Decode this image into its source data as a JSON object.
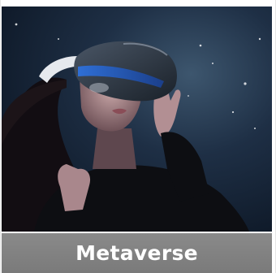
{
  "card": {
    "title": "Metaverse",
    "image_subject": "vr-headset-woman-photo"
  },
  "colors": {
    "caption_background": "#7f7f7f",
    "caption_text": "#ffffff",
    "photo_background": "#162438"
  }
}
